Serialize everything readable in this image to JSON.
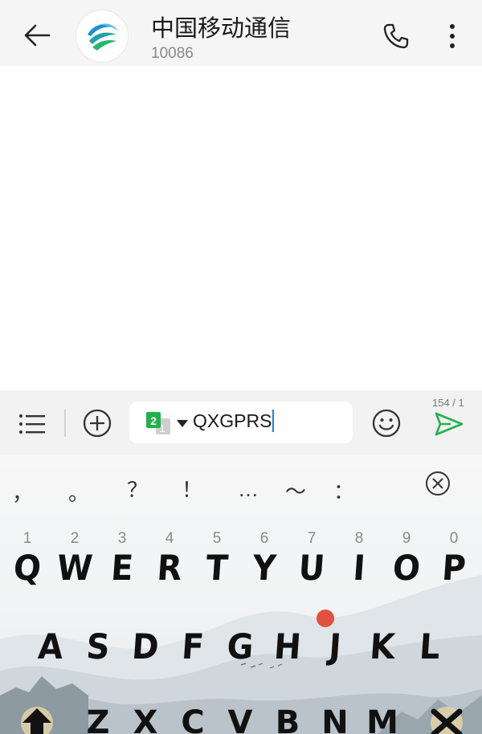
{
  "header": {
    "title": "中国移动通信",
    "number": "10086",
    "back_icon": "arrow-left-icon",
    "call_icon": "phone-icon",
    "more_icon": "more-vertical-icon",
    "avatar_icon": "china-mobile-logo"
  },
  "composer": {
    "input_value": "QXGPRS",
    "sim_slot": "2",
    "char_counter": "154 / 1",
    "accent_color": "#22b14c",
    "cursor_color": "#1e7cf0"
  },
  "keyboard": {
    "symbols": [
      "，",
      "。",
      "？",
      "！",
      "…",
      "～",
      "："
    ],
    "clear_icon": "circle-x-icon",
    "numbers": [
      "1",
      "2",
      "3",
      "4",
      "5",
      "6",
      "7",
      "8",
      "9",
      "0"
    ],
    "row1": [
      "Q",
      "W",
      "E",
      "R",
      "T",
      "Y",
      "U",
      "I",
      "O",
      "P"
    ],
    "row2": [
      "A",
      "S",
      "D",
      "F",
      "G",
      "H",
      "J",
      "K",
      "L"
    ],
    "row3": [
      "Z",
      "X",
      "C",
      "V",
      "B",
      "N",
      "M"
    ],
    "shift_icon": "shift-arrow-icon",
    "delete_icon": "backspace-icon"
  }
}
